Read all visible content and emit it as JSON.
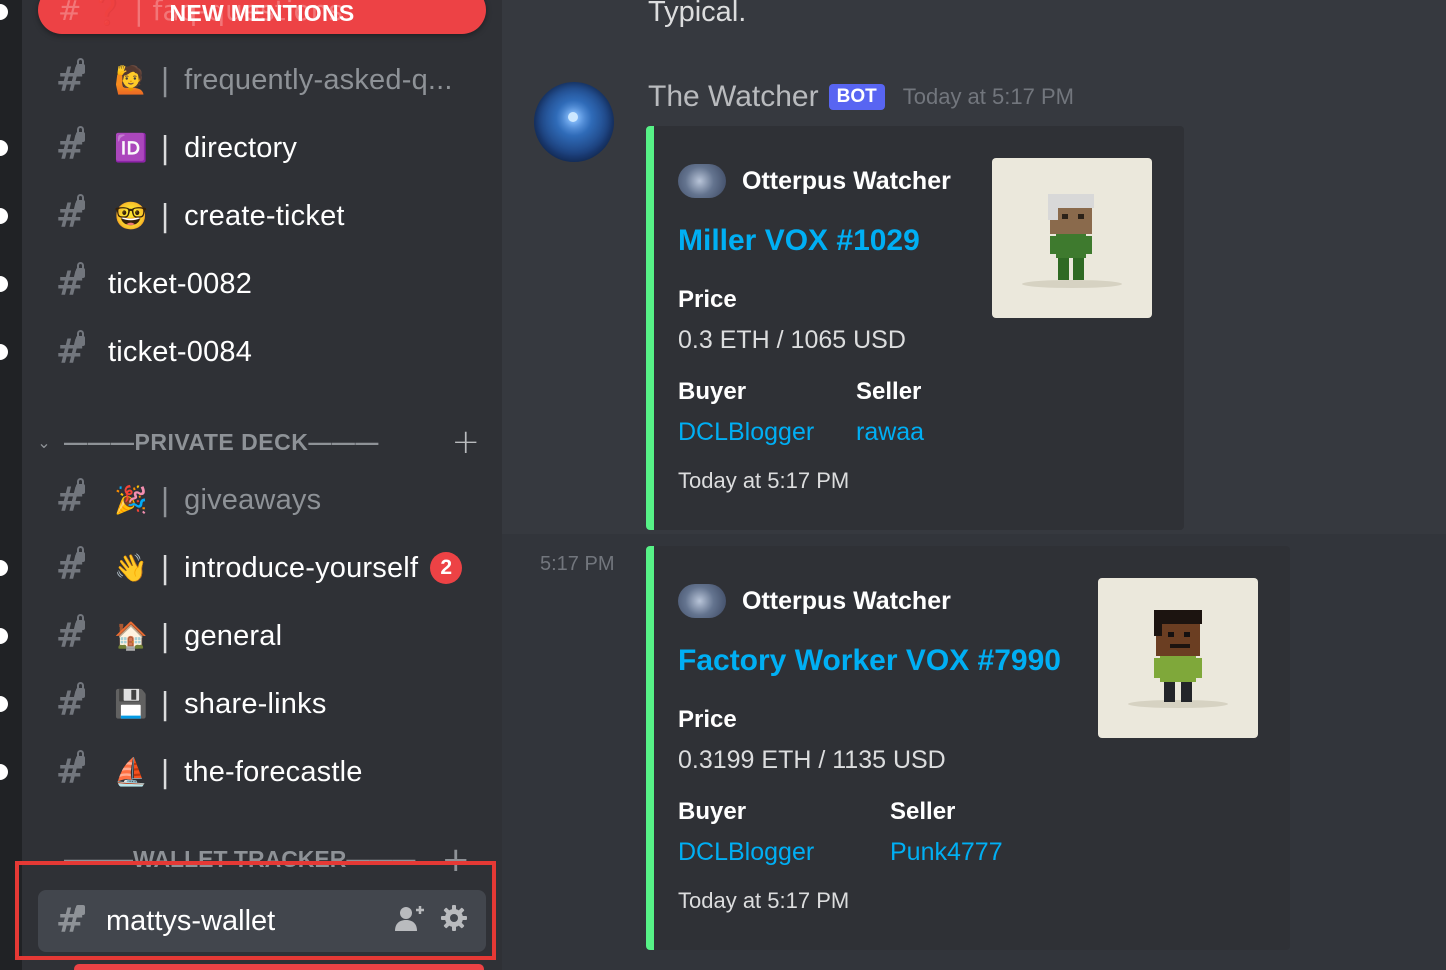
{
  "sidebar": {
    "new_mentions_label": "NEW MENTIONS",
    "new_mentions_ghost": "#  ❓ | faq-questions",
    "channels_top": [
      {
        "emoji": "🙋",
        "name": "frequently-asked-q...",
        "muted": true
      },
      {
        "emoji": "🆔",
        "name": "directory",
        "muted": false
      },
      {
        "emoji": "🤓",
        "name": "create-ticket",
        "muted": false
      },
      {
        "emoji": "",
        "name": "ticket-0082",
        "muted": false
      },
      {
        "emoji": "",
        "name": "ticket-0084",
        "muted": false
      }
    ],
    "private_deck": {
      "title": "———PRIVATE DECK———",
      "channels": [
        {
          "emoji": "🎉",
          "name": "giveaways",
          "muted": true
        },
        {
          "emoji": "👋",
          "name": "introduce-yourself",
          "badge": "2"
        },
        {
          "emoji": "🏠",
          "name": "general"
        },
        {
          "emoji": "💾",
          "name": "share-links"
        },
        {
          "emoji": "⛵",
          "name": "the-forecastle"
        }
      ]
    },
    "wallet_tracker": {
      "title": "———WALLET TRACKER———",
      "selected_channel": "mattys-wallet"
    }
  },
  "chat": {
    "previous_message_text": "Typical.",
    "author": "The Watcher",
    "bot_tag": "BOT",
    "timestamp": "Today at 5:17 PM",
    "gutter_time": "5:17 PM",
    "embeds": [
      {
        "author": "Otterpus Watcher",
        "title": "Miller VOX #1029",
        "price_label": "Price",
        "price_value": "0.3 ETH / 1065 USD",
        "buyer_label": "Buyer",
        "buyer": "DCLBlogger",
        "seller_label": "Seller",
        "seller": "rawaa",
        "footer": "Today at 5:17 PM"
      },
      {
        "author": "Otterpus Watcher",
        "title": "Factory Worker VOX #7990",
        "price_label": "Price",
        "price_value": "0.3199 ETH / 1135 USD",
        "buyer_label": "Buyer",
        "buyer": "DCLBlogger",
        "seller_label": "Seller",
        "seller": "Punk4777",
        "footer": "Today at 5:17 PM"
      }
    ]
  },
  "colors": {
    "embed_accent": "#57f287",
    "link": "#00aff4",
    "mention_red": "#ed4245",
    "bot_blurple": "#5865f2"
  }
}
